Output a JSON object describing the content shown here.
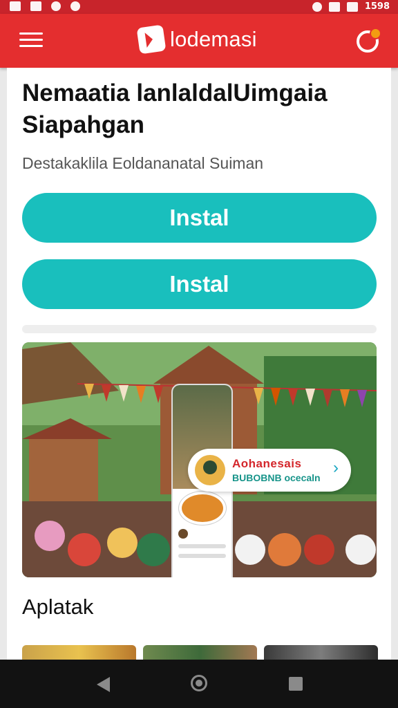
{
  "status_bar": {
    "time": "1598"
  },
  "app_bar": {
    "brand": "lodemasi"
  },
  "content": {
    "title": "Nemaatia lanlaldalUimgaia Siapahgan",
    "subtitle": "Destakaklila Eoldananatal Suiman",
    "install_button_1": "Instal",
    "install_button_2": "Instal",
    "hero_card": {
      "title": "Aohanesais",
      "subtitle": "BUBOBNB ocecaln"
    },
    "section_title": "Aplatak"
  },
  "colors": {
    "app_bar": "#e42e2f",
    "button": "#19bfbd",
    "nav_bar": "#121212"
  }
}
